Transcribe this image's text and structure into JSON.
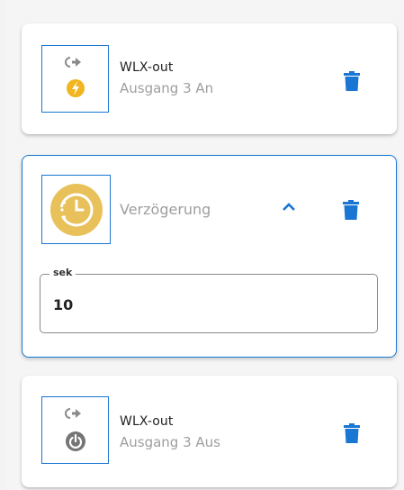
{
  "colors": {
    "accent": "#1976d2",
    "warning_yellow": "#f0b51f",
    "timer_yellow": "#e8c15a",
    "power_gray": "#757575",
    "subtitle_gray": "#9e9e9e"
  },
  "cards": [
    {
      "type": "output",
      "icon": "output-arrow-icon",
      "badge_icon": "lightning-bolt-icon",
      "title": "WLX-out",
      "subtitle": "Ausgang 3 An",
      "delete_icon": "trash-icon"
    },
    {
      "type": "delay",
      "icon": "timer-clock-icon",
      "subtitle": "Verzögerung",
      "expanded": true,
      "collapse_icon": "chevron-up-icon",
      "delete_icon": "trash-icon",
      "field": {
        "label": "sek",
        "value": "10"
      }
    },
    {
      "type": "output",
      "icon": "output-arrow-icon",
      "badge_icon": "power-icon",
      "title": "WLX-out",
      "subtitle": "Ausgang 3 Aus",
      "delete_icon": "trash-icon"
    }
  ]
}
